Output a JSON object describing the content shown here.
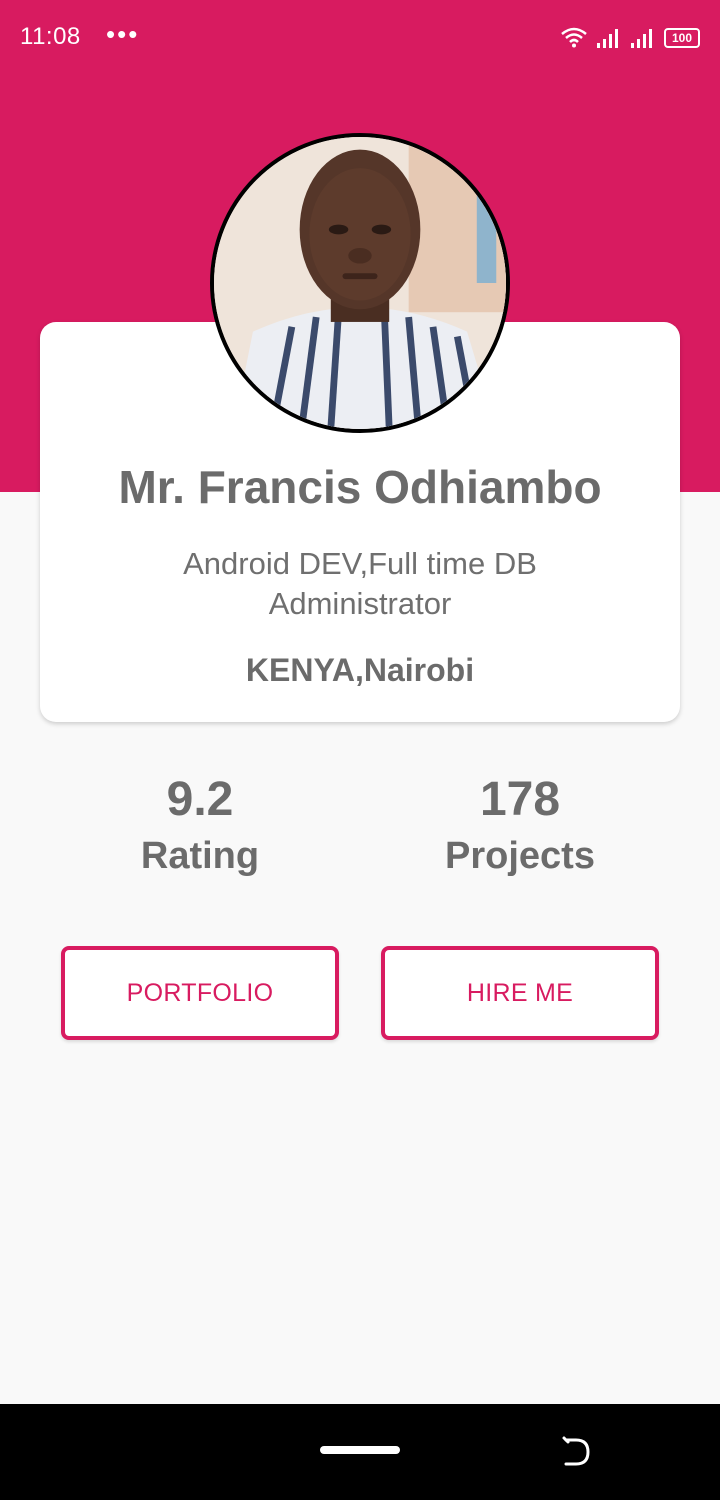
{
  "status_bar": {
    "time": "11:08",
    "notification_dots": "•••",
    "battery_level": "100",
    "icons": [
      "wifi-icon",
      "signal-icon",
      "signal-icon",
      "battery-icon"
    ]
  },
  "profile": {
    "name": "Mr. Francis Odhiambo",
    "title": "Android DEV,Full time DB Administrator",
    "location": "KENYA,Nairobi"
  },
  "stats": {
    "rating": {
      "value": "9.2",
      "label": "Rating"
    },
    "projects": {
      "value": "178",
      "label": "Projects"
    }
  },
  "actions": {
    "portfolio_label": "PORTFOLIO",
    "hire_label": "HIRE ME"
  },
  "colors": {
    "accent": "#d81b60",
    "background": "#f9f9f9",
    "text": "#6b6b6b"
  }
}
